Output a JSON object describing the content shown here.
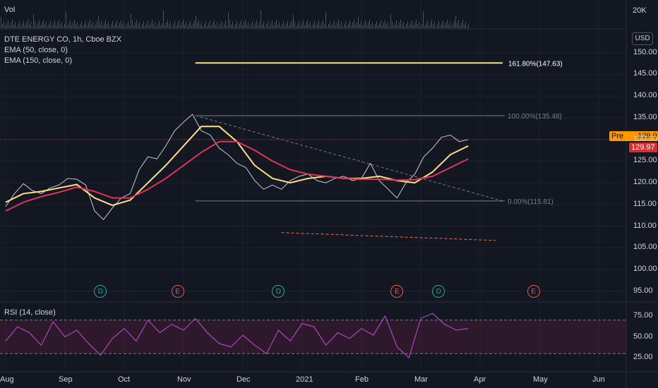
{
  "colors": {
    "background": "#131722",
    "grid": "#1e222d",
    "price": "#c8cbd4",
    "ema50": "#ffe082",
    "ema150": "#e0325a",
    "rsi": "#ab47bc",
    "fib": "#ffe082",
    "dividend": "#26a69a",
    "earnings": "#ef5350",
    "last_price_tag": "#d32f2f",
    "pre_tag": "#ff9800",
    "volume": "#26a69a"
  },
  "volume_pane": {
    "label": "Vol",
    "axis_label": "20K"
  },
  "legend": {
    "symbol": "DTE ENERGY CO, 1h, Cboe BZX",
    "ema50": "EMA (50, close, 0)",
    "ema150": "EMA (150, close, 0)"
  },
  "currency": "USD",
  "price_tags": {
    "pre_label": "Pre",
    "pre_value": "129.97",
    "last_value": "129.97"
  },
  "fibonacci": [
    {
      "label": "161.80%(147.63)",
      "level": 147.63
    },
    {
      "label": "100.00%(135.48)",
      "level": 135.48
    },
    {
      "label": "0.00%(115.81)",
      "level": 115.81
    }
  ],
  "events": [
    {
      "type": "D",
      "month_pos": 1.6
    },
    {
      "type": "E",
      "month_pos": 2.9
    },
    {
      "type": "D",
      "month_pos": 4.6
    },
    {
      "type": "E",
      "month_pos": 6.6
    },
    {
      "type": "D",
      "month_pos": 7.3
    },
    {
      "type": "E",
      "month_pos": 8.9
    }
  ],
  "rsi_pane": {
    "label": "RSI (14, close)",
    "upper_band": 70,
    "lower_band": 30
  },
  "chart_data": {
    "type": "line",
    "title": "DTE ENERGY CO, 1h, Cboe BZX",
    "x_tick_labels": [
      "Aug",
      "Sep",
      "Oct",
      "Nov",
      "Dec",
      "2021",
      "Feb",
      "Mar",
      "Apr",
      "May",
      "Jun"
    ],
    "y_tick_labels": [
      "95.00",
      "100.00",
      "105.00",
      "110.00",
      "115.00",
      "120.00",
      "125.00",
      "130.00",
      "135.00",
      "140.00",
      "145.00",
      "150.00"
    ],
    "ylim": [
      93,
      155
    ],
    "rsi_tick_labels": [
      "25.00",
      "50.00",
      "75.00"
    ],
    "rsi_ylim": [
      10,
      90
    ],
    "x_unit": "months since Aug 1",
    "x_range": [
      0,
      10.6
    ],
    "series": [
      {
        "name": "DTE ENERGY CO",
        "x": [
          0.0,
          0.15,
          0.3,
          0.45,
          0.6,
          0.75,
          0.9,
          1.05,
          1.2,
          1.35,
          1.5,
          1.65,
          1.8,
          1.95,
          2.1,
          2.25,
          2.4,
          2.55,
          2.7,
          2.85,
          3.0,
          3.15,
          3.3,
          3.45,
          3.6,
          3.75,
          3.9,
          4.05,
          4.2,
          4.35,
          4.5,
          4.65,
          4.8,
          4.95,
          5.1,
          5.25,
          5.4,
          5.55,
          5.7,
          5.85,
          6.0,
          6.15,
          6.3,
          6.45,
          6.6,
          6.75,
          6.9,
          7.05,
          7.2,
          7.35,
          7.5,
          7.65,
          7.8
        ],
        "values": [
          114.5,
          117.5,
          119.8,
          118.2,
          117.5,
          118.8,
          119.5,
          121.0,
          120.8,
          119.5,
          113.5,
          111.5,
          114.2,
          116.5,
          117.5,
          123.0,
          126.0,
          125.5,
          128.5,
          132.0,
          134.0,
          135.8,
          132.0,
          131.0,
          128.0,
          126.5,
          124.5,
          123.5,
          120.5,
          118.5,
          119.5,
          118.5,
          120.5,
          121.5,
          122.0,
          120.5,
          120.0,
          121.0,
          121.5,
          120.5,
          121.0,
          124.5,
          120.5,
          118.5,
          116.5,
          120.0,
          122.0,
          126.0,
          128.0,
          130.5,
          131.0,
          129.5,
          129.97
        ]
      },
      {
        "name": "EMA (50, close, 0)",
        "x": [
          0.0,
          0.3,
          0.6,
          0.9,
          1.2,
          1.5,
          1.8,
          2.1,
          2.4,
          2.7,
          3.0,
          3.3,
          3.6,
          3.9,
          4.2,
          4.5,
          4.8,
          5.1,
          5.4,
          5.7,
          6.0,
          6.3,
          6.6,
          6.9,
          7.2,
          7.5,
          7.8
        ],
        "values": [
          115.5,
          117.5,
          118.0,
          118.8,
          119.6,
          116.5,
          114.8,
          116.0,
          120.0,
          124.0,
          128.5,
          133.0,
          133.0,
          129.5,
          124.0,
          121.0,
          120.0,
          121.0,
          121.5,
          121.0,
          121.0,
          121.5,
          120.5,
          120.0,
          122.5,
          126.5,
          128.5
        ]
      },
      {
        "name": "EMA (150, close, 0)",
        "x": [
          0.0,
          0.3,
          0.6,
          0.9,
          1.2,
          1.5,
          1.8,
          2.1,
          2.4,
          2.7,
          3.0,
          3.3,
          3.6,
          3.9,
          4.2,
          4.5,
          4.8,
          5.1,
          5.4,
          5.7,
          6.0,
          6.3,
          6.6,
          6.9,
          7.2,
          7.5,
          7.8
        ],
        "values": [
          113.5,
          115.5,
          116.8,
          117.8,
          119.0,
          118.0,
          116.5,
          116.5,
          118.5,
          121.0,
          124.0,
          127.0,
          129.5,
          129.5,
          127.5,
          125.0,
          123.0,
          122.0,
          121.5,
          121.0,
          120.8,
          120.8,
          120.6,
          120.7,
          121.5,
          123.5,
          125.5
        ]
      },
      {
        "name": "RSI (14, close)",
        "x": [
          0.0,
          0.2,
          0.4,
          0.6,
          0.8,
          1.0,
          1.2,
          1.4,
          1.6,
          1.8,
          2.0,
          2.2,
          2.4,
          2.6,
          2.8,
          3.0,
          3.2,
          3.4,
          3.6,
          3.8,
          4.0,
          4.2,
          4.4,
          4.6,
          4.8,
          5.0,
          5.2,
          5.4,
          5.6,
          5.8,
          6.0,
          6.2,
          6.4,
          6.6,
          6.8,
          7.0,
          7.2,
          7.4,
          7.6,
          7.8
        ],
        "values": [
          45,
          62,
          55,
          40,
          68,
          50,
          58,
          42,
          28,
          48,
          60,
          45,
          70,
          55,
          65,
          58,
          72,
          55,
          42,
          38,
          52,
          40,
          30,
          58,
          45,
          66,
          62,
          40,
          55,
          48,
          60,
          52,
          75,
          38,
          25,
          72,
          78,
          65,
          58,
          60
        ]
      }
    ]
  }
}
